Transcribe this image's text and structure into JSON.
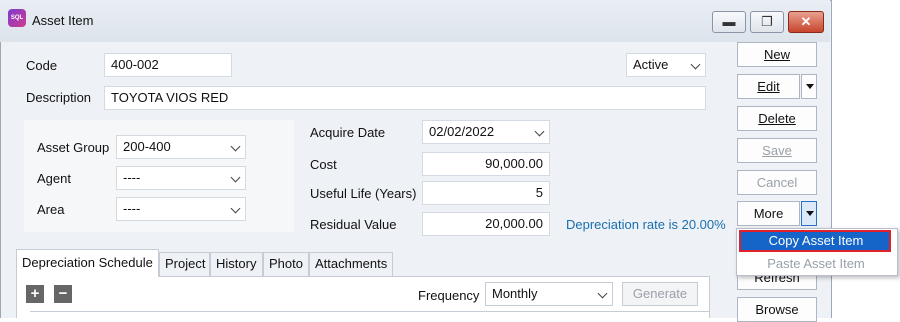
{
  "window": {
    "title": "Asset Item",
    "app_icon_text": "SQL",
    "controls": {
      "minimize": "▬",
      "restore": "❐",
      "close": "✕"
    }
  },
  "form": {
    "code_label": "Code",
    "code_value": "400-002",
    "status_value": "Active",
    "description_label": "Description",
    "description_value": "TOYOTA VIOS RED",
    "asset_group_label": "Asset Group",
    "asset_group_value": "200-400",
    "agent_label": "Agent",
    "agent_value": "----",
    "area_label": "Area",
    "area_value": "----",
    "acquire_date_label": "Acquire Date",
    "acquire_date_value": "02/02/2022",
    "cost_label": "Cost",
    "cost_value": "90,000.00",
    "useful_life_label": "Useful Life (Years)",
    "useful_life_value": "5",
    "residual_label": "Residual Value",
    "residual_value": "20,000.00",
    "depreciation_note": "Depreciation rate is 20.00%"
  },
  "buttons": {
    "new": "New",
    "edit": "Edit",
    "delete": "Delete",
    "save": "Save",
    "cancel": "Cancel",
    "more": "More",
    "refresh": "Refresh",
    "browse": "Browse"
  },
  "more_menu": {
    "items": [
      "Copy Asset Item",
      "Paste Asset Item"
    ]
  },
  "tabs": [
    "Depreciation Schedule",
    "Project",
    "History",
    "Photo",
    "Attachments"
  ],
  "schedule": {
    "frequency_label": "Frequency",
    "frequency_value": "Monthly",
    "generate_label": "Generate",
    "add_icon": "+",
    "remove_icon": "−"
  },
  "colors": {
    "accent_blue": "#1565c8",
    "highlight_border": "#e0202a",
    "note_blue": "#1a6fb0"
  }
}
